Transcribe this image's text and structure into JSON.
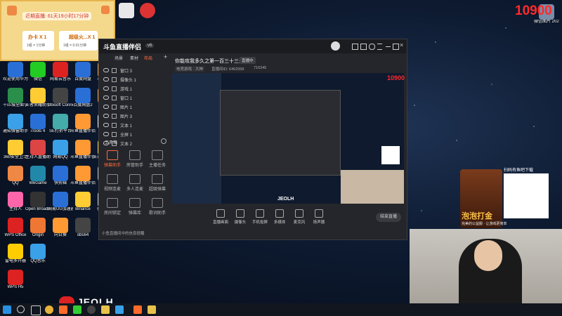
{
  "desktop": {
    "top_banner": {
      "title": "近期直播: 61天19小时17分钟",
      "card1": "100亿元",
      "card2": "超级火...X 1",
      "card2_sub": "1组 = 0.01分钟",
      "card1_sub": "1组 = 1分钟",
      "card1_label": "办卡 X 1"
    },
    "corner_counter": "10900",
    "corner_counter_small": "10900",
    "overlay_brand": "JEOLH",
    "icons_col1": [
      "欢迎使用华为浏览器助手",
      "千匹城全面学习",
      "通知弹窗助手",
      "360安全卫士",
      "QQ",
      "主持人",
      "WPS Office",
      "雷电多开器",
      "WPS H5"
    ],
    "icons_col2": [
      "微信",
      "王者荣耀助手",
      "iTools 4",
      "主持人直播助手",
      "WeGame",
      "Open Broadcast...",
      "Origin",
      "QQ音乐"
    ],
    "icons_col3": [
      "网易云音乐",
      "Ubisoft Connect",
      "SE打折平台",
      "网易QQ",
      "快剪辑",
      "网易UU加速器",
      "向日葵"
    ],
    "icons_col4": [
      "百度网盘",
      "百度网盘2",
      "斗鱼直播伴侣",
      "斗鱼直播伴侣3",
      "斗鱼直播伴侣4",
      "Binance",
      "obs64"
    ],
    "icons_col5": [
      "斗鱼直播",
      "直播姬",
      "录像",
      "头条直播盒子",
      "微视剧",
      "微信图片"
    ],
    "desk_right": [
      "微信图片",
      "微信图片 2021082..."
    ]
  },
  "obs_window": {
    "title": "你能攻我多久之第一百三十三天!",
    "tag": "直播中",
    "sub1": "电竞游戏 · 大神",
    "sub2": "直播间ID: 6462999",
    "viewers": "716345",
    "brand": "斗鱼直播伴侣",
    "version": "v6",
    "tabs": [
      "场景",
      "素材",
      "布局"
    ],
    "scenes": [
      "窗口 3",
      "摄像头 1",
      "游戏 1",
      "窗口 1",
      "图片 1",
      "图片 3",
      "文本 1",
      "全屏 1",
      "文本 2"
    ],
    "toolbox_title": "工具箱",
    "tools": [
      "弹幕助手",
      "房管助手",
      "主播任务",
      "视频连麦",
      "多人连麦",
      "超级弹幕",
      "房间锁定",
      "弹幕库",
      "歌词助手"
    ],
    "notice": "小鱼直播间中的信息提醒",
    "bottom_buttons": [
      "直播画面",
      "摄像头",
      "手机投屏",
      "多媒体",
      "麦克风",
      "扬声器"
    ],
    "cpu": "CPU: 26%",
    "fps": "FPS: 60",
    "bitrate": "码率: 8000kbps",
    "start_button": "结束直播",
    "overlay_counter": "10900",
    "overlay_brand": "JEOLH"
  },
  "ad_panel": {
    "scan_text": "扫码有鱼吧下载",
    "game_title": "泡泡打金",
    "sub": "完美的公益服 · 让游戏更简单"
  },
  "taskbar": {
    "items": [
      "start",
      "search",
      "taskview",
      "chrome",
      "douyu",
      "wechat",
      "obs",
      "explorer",
      "qq"
    ]
  }
}
